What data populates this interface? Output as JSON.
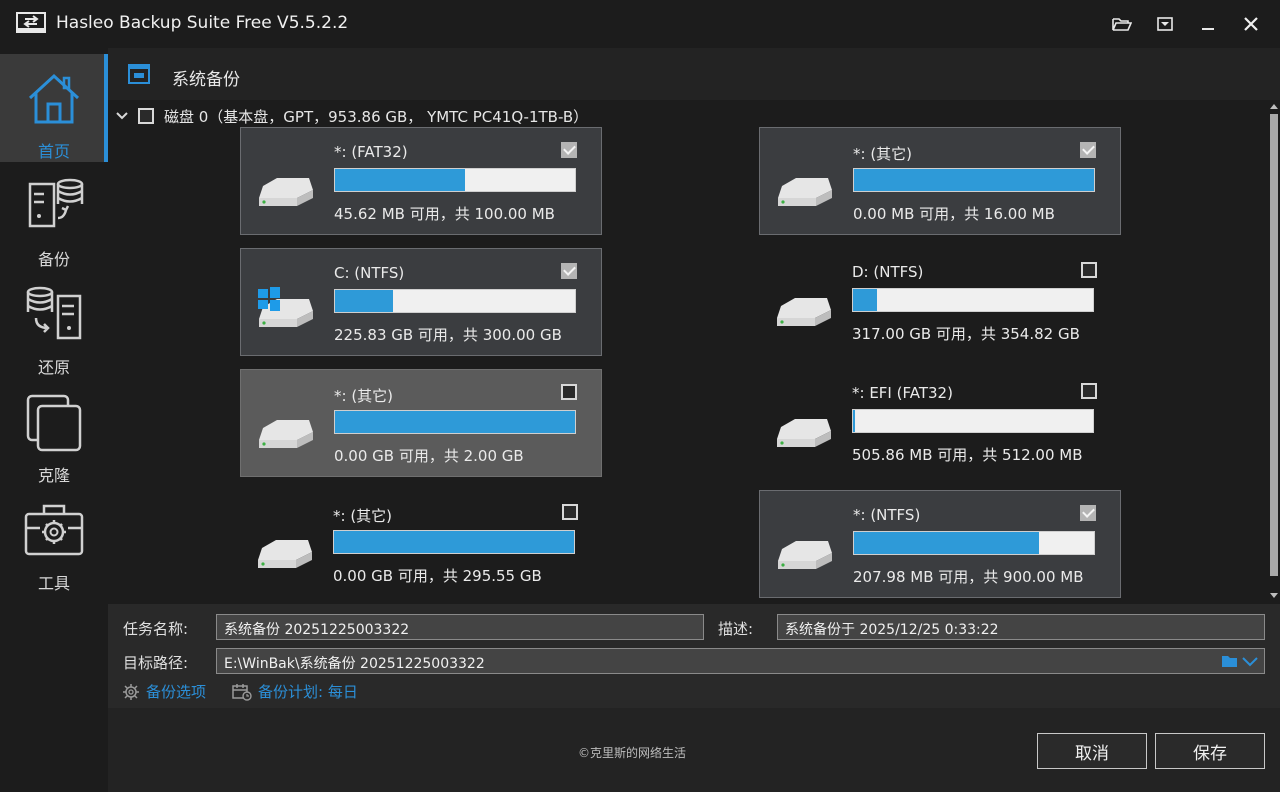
{
  "app": {
    "title": "Hasleo Backup Suite Free V5.5.2.2"
  },
  "sidebar": {
    "items": [
      {
        "label": "首页",
        "icon": "home-icon",
        "active": true
      },
      {
        "label": "备份",
        "icon": "backup-icon",
        "active": false
      },
      {
        "label": "还原",
        "icon": "restore-icon",
        "active": false
      },
      {
        "label": "克隆",
        "icon": "clone-icon",
        "active": false
      },
      {
        "label": "工具",
        "icon": "tools-icon",
        "active": false
      }
    ]
  },
  "section": {
    "title": "系统备份"
  },
  "disk": {
    "label": "磁盘 0（基本盘，GPT，953.86 GB， YMTC PC41Q-1TB-B）"
  },
  "partitions": [
    {
      "name": "*: (FAT32)",
      "stat": "45.62 MB 可用，共 100.00 MB",
      "used_fraction": 0.54,
      "checked": true,
      "style": "framed"
    },
    {
      "name": "*: (其它)",
      "stat": "0.00 MB 可用，共 16.00 MB",
      "used_fraction": 1.0,
      "checked": true,
      "style": "framed"
    },
    {
      "name": "C: (NTFS)",
      "stat": "225.83 GB 可用，共 300.00 GB",
      "used_fraction": 0.24,
      "checked": true,
      "style": "framed"
    },
    {
      "name": "D: (NTFS)",
      "stat": "317.00 GB 可用，共 354.82 GB",
      "used_fraction": 0.1,
      "checked": false,
      "style": "plain"
    },
    {
      "name": "*: (其它)",
      "stat": "0.00 GB 可用，共 2.00 GB",
      "used_fraction": 1.0,
      "checked": false,
      "style": "selected"
    },
    {
      "name": "*: EFI (FAT32)",
      "stat": "505.86 MB 可用，共 512.00 MB",
      "used_fraction": 0.01,
      "checked": false,
      "style": "plain"
    },
    {
      "name": "*: (其它)",
      "stat": "0.00 GB 可用，共 295.55 GB",
      "used_fraction": 1.0,
      "checked": false,
      "style": "plain"
    },
    {
      "name": "*: (NTFS)",
      "stat": "207.98 MB 可用，共 900.00 MB",
      "used_fraction": 0.77,
      "checked": true,
      "style": "framed"
    }
  ],
  "form": {
    "task_name_label": "任务名称:",
    "task_name_value": "系统备份 20251225003322",
    "desc_label": "描述:",
    "desc_value": "系统备份于 2025/12/25 0:33:22",
    "target_label": "目标路径:",
    "target_value": "E:\\WinBak\\系统备份 20251225003322",
    "options_link": "备份选项",
    "schedule_link": "备份计划: 每日"
  },
  "footer": {
    "copyright": "©克里斯的网络生活",
    "cancel": "取消",
    "save": "保存"
  },
  "colors": {
    "accent": "#2b8fd8",
    "bar_fill": "#2e9ad8"
  }
}
